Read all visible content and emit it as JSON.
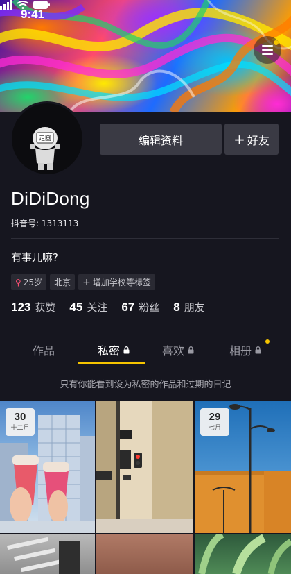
{
  "status_bar": {
    "time": "9:41"
  },
  "profile": {
    "name": "DiDiDong",
    "douyin_id": "抖音号: 1313113",
    "bio": "有事儿嘛?",
    "avatar_text": "走圆"
  },
  "buttons": {
    "edit_profile": "编辑资料",
    "add_friend_plus": "+",
    "add_friend": "好友"
  },
  "tags": {
    "age_icon": "♀",
    "age": "25岁",
    "city": "北京",
    "add_school_plus": "+",
    "add_school": "增加学校等标签"
  },
  "stats": [
    {
      "value": "123",
      "label": "获赞"
    },
    {
      "value": "45",
      "label": "关注"
    },
    {
      "value": "67",
      "label": "粉丝"
    },
    {
      "value": "8",
      "label": "朋友"
    }
  ],
  "tabs": [
    {
      "label": "作品"
    },
    {
      "label": "私密"
    },
    {
      "label": "喜欢"
    },
    {
      "label": "相册"
    }
  ],
  "private_note": "只有你能看到设为私密的作品和过期的日记",
  "grid": {
    "items": [
      {
        "day": "30",
        "month": "十二月"
      },
      {
        "day": "",
        "month": ""
      },
      {
        "day": "29",
        "month": "七月"
      }
    ]
  },
  "colors": {
    "accent": "#f5c400",
    "background": "#16161f",
    "button": "#3a3a44"
  },
  "icons": [
    "menu-icon",
    "lock-icon",
    "female-icon",
    "signal-icon",
    "wifi-icon",
    "battery-icon"
  ]
}
